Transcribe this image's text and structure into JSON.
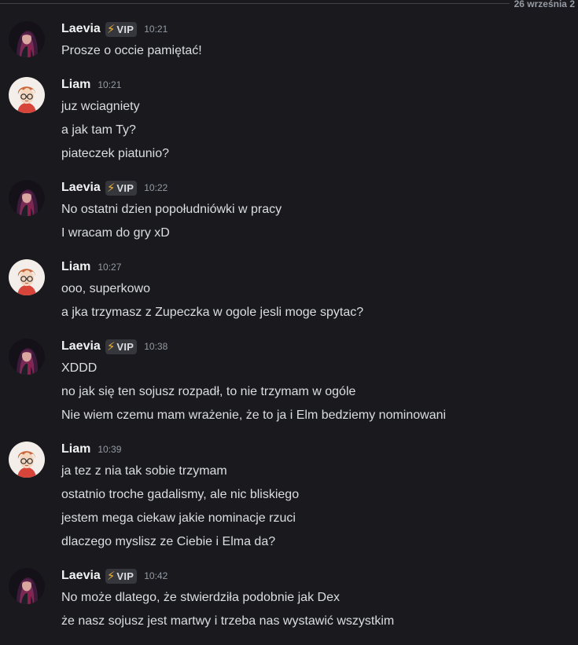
{
  "divider": {
    "date_label": "26 września 2"
  },
  "colors": {
    "background": "#1a1a1e",
    "vip_bolt": "#f0b232",
    "text": "#dbdee1",
    "timestamp": "#949ba4"
  },
  "badge": {
    "icon": "lightning-bolt-icon",
    "text": "VIP"
  },
  "groups": [
    {
      "author": "Laevia",
      "vip": true,
      "time": "10:21",
      "lines": [
        "Prosze o occie pamiętać!"
      ]
    },
    {
      "author": "Liam",
      "vip": false,
      "time": "10:21",
      "lines": [
        "juz wciagniety",
        "a jak tam Ty?",
        "piateczek piatunio?"
      ]
    },
    {
      "author": "Laevia",
      "vip": true,
      "time": "10:22",
      "lines": [
        "No ostatni dzien popołudniówki w pracy",
        "I wracam do gry xD"
      ]
    },
    {
      "author": "Liam",
      "vip": false,
      "time": "10:27",
      "lines": [
        "ooo, superkowo",
        "a jka trzymasz z Zupeczka w ogole jesli moge spytac?"
      ]
    },
    {
      "author": "Laevia",
      "vip": true,
      "time": "10:38",
      "lines": [
        "XDDD",
        "no jak się ten sojusz rozpadł, to nie trzymam w ogóle",
        "Nie wiem czemu mam wrażenie, że to ja i Elm bedziemy nominowani"
      ]
    },
    {
      "author": "Liam",
      "vip": false,
      "time": "10:39",
      "lines": [
        "ja tez z nia tak sobie trzymam",
        "ostatnio troche gadalismy, ale nic bliskiego",
        "jestem mega ciekaw jakie nominacje rzuci",
        "dlaczego myslisz ze Ciebie i Elma da?"
      ]
    },
    {
      "author": "Laevia",
      "vip": true,
      "time": "10:42",
      "lines": [
        "No może dlatego, że stwierdziła podobnie jak Dex",
        "że nasz sojusz jest martwy i trzeba nas wystawić wszystkim"
      ]
    }
  ]
}
